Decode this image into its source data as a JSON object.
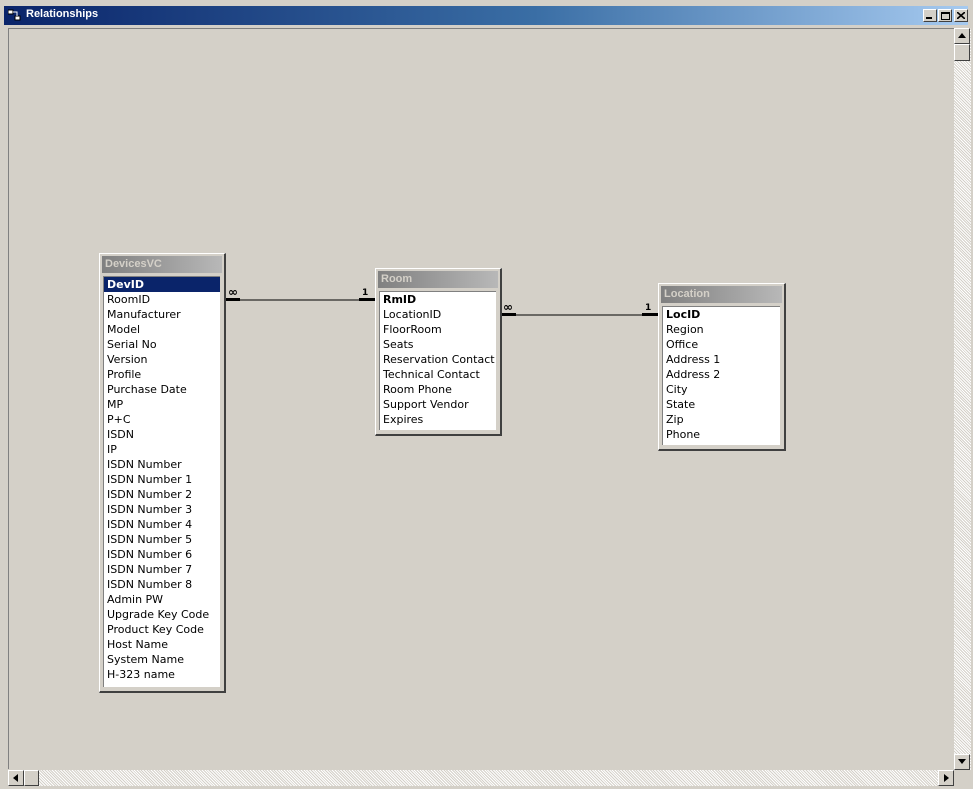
{
  "window": {
    "title": "Relationships",
    "icon": "relationships-icon",
    "buttons": [
      "minimize-icon",
      "maximize-icon",
      "close-icon"
    ]
  },
  "tables": {
    "devices": {
      "name": "DevicesVC",
      "fields": [
        "DevID",
        "RoomID",
        "Manufacturer",
        "Model",
        "Serial No",
        "Version",
        "Profile",
        "Purchase Date",
        "MP",
        "P+C",
        "ISDN",
        "IP",
        "ISDN Number",
        "ISDN Number 1",
        "ISDN Number 2",
        "ISDN Number 3",
        "ISDN Number 4",
        "ISDN Number 5",
        "ISDN Number 6",
        "ISDN Number 7",
        "ISDN Number 8",
        "Admin PW",
        "Upgrade Key Code",
        "Product Key Code",
        "Host Name",
        "System Name",
        "H-323 name"
      ]
    },
    "room": {
      "name": "Room",
      "fields": [
        "RmID",
        "LocationID",
        "FloorRoom",
        "Seats",
        "Reservation Contact",
        "Technical Contact",
        "Room Phone",
        "Support Vendor",
        "Expires"
      ]
    },
    "location": {
      "name": "Location",
      "fields": [
        "LocID",
        "Region",
        "Office",
        "Address 1",
        "Address 2",
        "City",
        "State",
        "Zip",
        "Phone"
      ]
    }
  },
  "relationships": {
    "devices_room": {
      "many": "∞",
      "one": "1"
    },
    "room_location": {
      "many": "∞",
      "one": "1"
    }
  }
}
